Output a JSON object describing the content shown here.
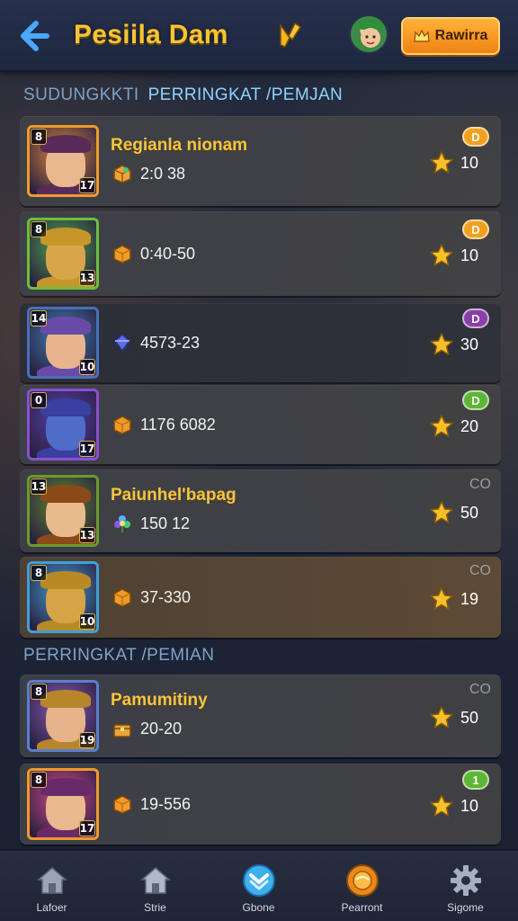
{
  "header": {
    "title": "Pesiila Dam",
    "rank_button_label": "Rawirra"
  },
  "sections": [
    {
      "heading_a": "SUDUNGKKTI",
      "heading_b": "PERRINGKAT /PEMJAN"
    },
    {
      "heading_a": "PERRINGKAT /PEMIAN"
    }
  ],
  "rows": [
    {
      "name": "Regianla nionam",
      "resource": "2:0 38",
      "resource_icon": "gem-cube-icon",
      "score": "10",
      "badge": "D",
      "badge_color": "#f2a11f",
      "portrait_frame": "#f09a2a",
      "tl": "8",
      "br": "17"
    },
    {
      "name": "",
      "resource": "0:40-50",
      "resource_icon": "orange-cube-icon",
      "score": "10",
      "badge": "D",
      "badge_color": "#f2a11f",
      "portrait_frame": "#6fbf3a",
      "tl": "8",
      "br": "13"
    },
    {
      "name": "",
      "resource": "4573-23",
      "resource_icon": "blue-gem-icon",
      "score": "30",
      "badge": "D",
      "badge_color": "#8a3fa8",
      "portrait_frame": "#4a6fb8",
      "tl": "14",
      "br": "10"
    },
    {
      "name": "",
      "resource": "1176 6082",
      "resource_icon": "orange-cube-icon",
      "score": "20",
      "badge": "D",
      "badge_color": "#5fb536",
      "portrait_frame": "#8a4fd0",
      "tl": "0",
      "br": "17"
    },
    {
      "name": "Paiunhel'bapag",
      "resource": "150 12",
      "resource_icon": "flower-gem-icon",
      "score": "50",
      "badge_text": "CO",
      "portrait_frame": "#6d9a2a",
      "tl": "13",
      "br": "13"
    },
    {
      "name": "",
      "resource": "37-330",
      "resource_icon": "orange-cube-icon",
      "score": "19",
      "badge_text": "CO",
      "portrait_frame": "#3f9fd8",
      "tl": "8",
      "br": "10"
    },
    {
      "name": "Pamumitiny",
      "resource": "20-20",
      "resource_icon": "chest-icon",
      "score": "50",
      "badge_text": "CO",
      "portrait_frame": "#5a7fd0",
      "tl": "8",
      "br": "19"
    },
    {
      "name": "",
      "resource": "19-556",
      "resource_icon": "orange-cube-icon",
      "score": "10",
      "badge": "1",
      "badge_color": "#5fb536",
      "portrait_frame": "#f09a2a",
      "tl": "8",
      "br": "17"
    }
  ],
  "nav": [
    {
      "label": "Lafoer",
      "icon": "home-icon"
    },
    {
      "label": "Strie",
      "icon": "house-icon"
    },
    {
      "label": "Gbone",
      "icon": "chevron-badge-icon"
    },
    {
      "label": "Pearront",
      "icon": "orange-medal-icon"
    },
    {
      "label": "Sigome",
      "icon": "gear-icon"
    }
  ],
  "colors": {
    "accent": "#f6c434",
    "rank_button": "#ef8212",
    "background": "#1c2335"
  }
}
